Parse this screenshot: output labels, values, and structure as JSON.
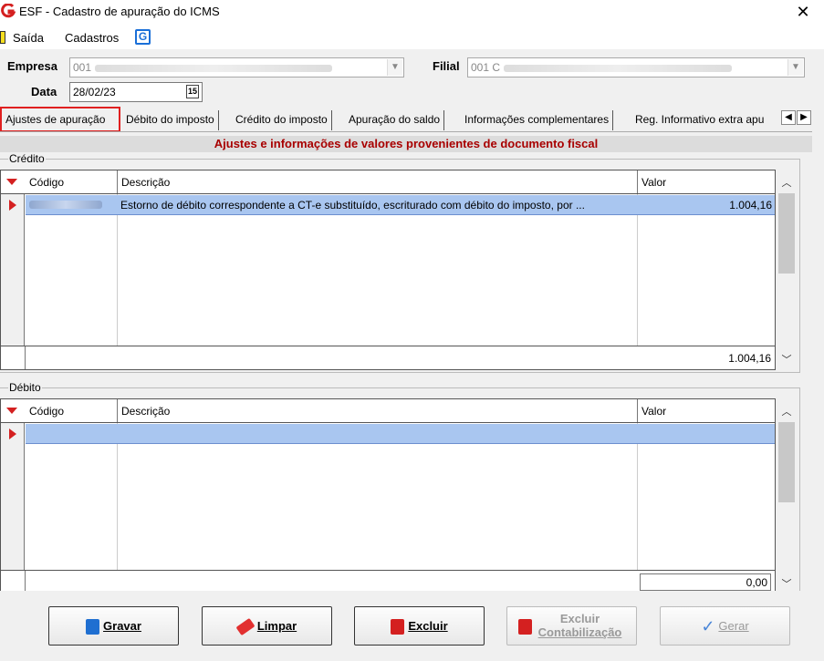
{
  "window": {
    "title": "ESF - Cadastro de apuração do ICMS",
    "close_glyph": "✕"
  },
  "menu": {
    "items": [
      "Saída",
      "Cadastros"
    ]
  },
  "form": {
    "empresa_label": "Empresa",
    "empresa_code": "001",
    "filial_label": "Filial",
    "filial_code": "001 C",
    "data_label": "Data",
    "data_value": "28/02/23",
    "calendar_glyph": "15"
  },
  "tabs": [
    "Ajustes de apuração",
    "Débito do imposto",
    "Crédito do imposto",
    "Apuração do saldo",
    "Informações complementares",
    "Reg. Informativo extra apu"
  ],
  "panel_header": "Ajustes e informações de valores provenientes de documento fiscal",
  "credito": {
    "group_label": "Crédito",
    "columns": [
      "Código",
      "Descrição",
      "Valor"
    ],
    "rows": [
      {
        "descricao": "Estorno de débito correspondente a CT-e substituído, escriturado com débito do imposto, por ...",
        "valor": "1.004,16"
      }
    ],
    "total": "1.004,16"
  },
  "debito": {
    "group_label": "Débito",
    "columns": [
      "Código",
      "Descrição",
      "Valor"
    ],
    "total": "0,00"
  },
  "buttons": {
    "gravar": "Gravar",
    "limpar": "Limpar",
    "excluir": "Excluir",
    "excluir_cont_1": "Excluir",
    "excluir_cont_2": "Contabilização",
    "gerar": "Gerar"
  },
  "colors": {
    "accent_red": "#d42020",
    "header_red": "#a80000",
    "selection": "#a9c6f0"
  }
}
